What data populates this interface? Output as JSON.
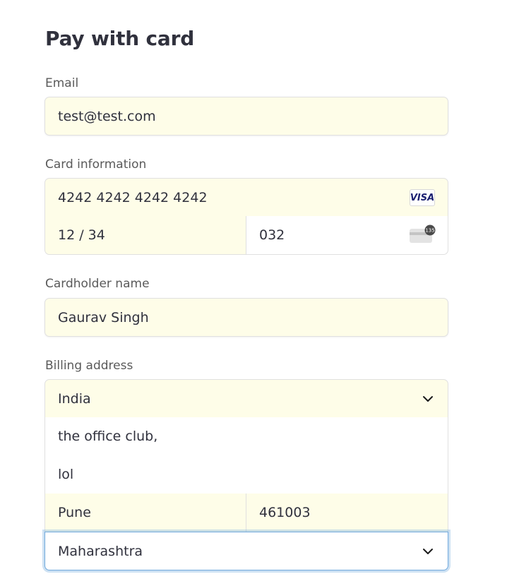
{
  "title": "Pay with card",
  "email": {
    "label": "Email",
    "value": "test@test.com"
  },
  "card": {
    "label": "Card information",
    "number": "4242 4242 4242 4242",
    "brand": "VISA",
    "expiry": "12 / 34",
    "cvc": "032",
    "cvc_icon_badge": "135"
  },
  "cardholder": {
    "label": "Cardholder name",
    "value": "Gaurav Singh"
  },
  "billing": {
    "label": "Billing address",
    "country": "India",
    "line1": "the office club,",
    "line2": "lol",
    "city": "Pune",
    "postal": "461003",
    "state": "Maharashtra"
  },
  "colors": {
    "autofill_bg": "#fefde8",
    "border": "#e0e0e0",
    "focus": "#6fa8dc"
  }
}
